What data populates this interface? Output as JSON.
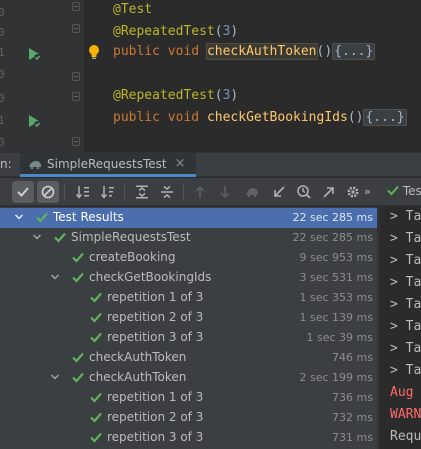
{
  "editor": {
    "lines": [
      {
        "annotation": "@Test"
      },
      {
        "annotation": "@RepeatedTest",
        "paren_open": "(",
        "arg": "3",
        "paren_close": ")"
      },
      {
        "kw1": "public",
        "kw2": "void",
        "method": "checkAuthToken",
        "parens": "()",
        "fold": "{...}"
      },
      {
        "annotation": "@RepeatedTest",
        "paren_open": "(",
        "arg": "3",
        "paren_close": ")"
      },
      {
        "kw1": "public",
        "kw2": "void",
        "method": "checkGetBookingIds",
        "parens": "()",
        "fold": "{...}"
      }
    ],
    "gutter_numbers": [
      "0",
      "0",
      "1",
      "0",
      "0",
      "1",
      "0"
    ]
  },
  "tool_window": {
    "prefix": "n:",
    "tab_label": "SimpleRequestsTest",
    "tab_close": "×"
  },
  "toolbar": {
    "more": "»",
    "run_label": "Test"
  },
  "test_tree": [
    {
      "label": "Test Results",
      "time": "22 sec 285 ms",
      "depth": 0,
      "expanded": true,
      "selected": true
    },
    {
      "label": "SimpleRequestsTest",
      "time": "22 sec 285 ms",
      "depth": 1,
      "expanded": true
    },
    {
      "label": "createBooking",
      "time": "9 sec 953 ms",
      "depth": 2
    },
    {
      "label": "checkGetBookingIds",
      "time": "3 sec 531 ms",
      "depth": 2,
      "expanded": true
    },
    {
      "label": "repetition 1 of 3",
      "time": "1 sec 353 ms",
      "depth": 3
    },
    {
      "label": "repetition 2 of 3",
      "time": "1 sec 139 ms",
      "depth": 3
    },
    {
      "label": "repetition 3 of 3",
      "time": "1 sec 39 ms",
      "depth": 3
    },
    {
      "label": "checkAuthToken",
      "time": "746 ms",
      "depth": 2
    },
    {
      "label": "checkAuthToken",
      "time": "2 sec 199 ms",
      "depth": 2,
      "expanded": true
    },
    {
      "label": "repetition 1 of 3",
      "time": "736 ms",
      "depth": 3
    },
    {
      "label": "repetition 2 of 3",
      "time": "732 ms",
      "depth": 3
    },
    {
      "label": "repetition 3 of 3",
      "time": "731 ms",
      "depth": 3
    }
  ],
  "console": [
    {
      "text": "> Ta"
    },
    {
      "text": "> Ta"
    },
    {
      "text": "> Ta"
    },
    {
      "text": "> Ta"
    },
    {
      "text": "> Ta"
    },
    {
      "text": "> Ta"
    },
    {
      "text": "> Ta"
    },
    {
      "text": "> Ta"
    },
    {
      "text": "Aug",
      "error": true
    },
    {
      "text": "WARN",
      "error": true
    },
    {
      "text": "Requ"
    }
  ],
  "colors": {
    "success": "#5fb359",
    "selection": "#4b6eaf",
    "tab_underline": "#4a88c7",
    "error_text": "#ff6b68"
  }
}
